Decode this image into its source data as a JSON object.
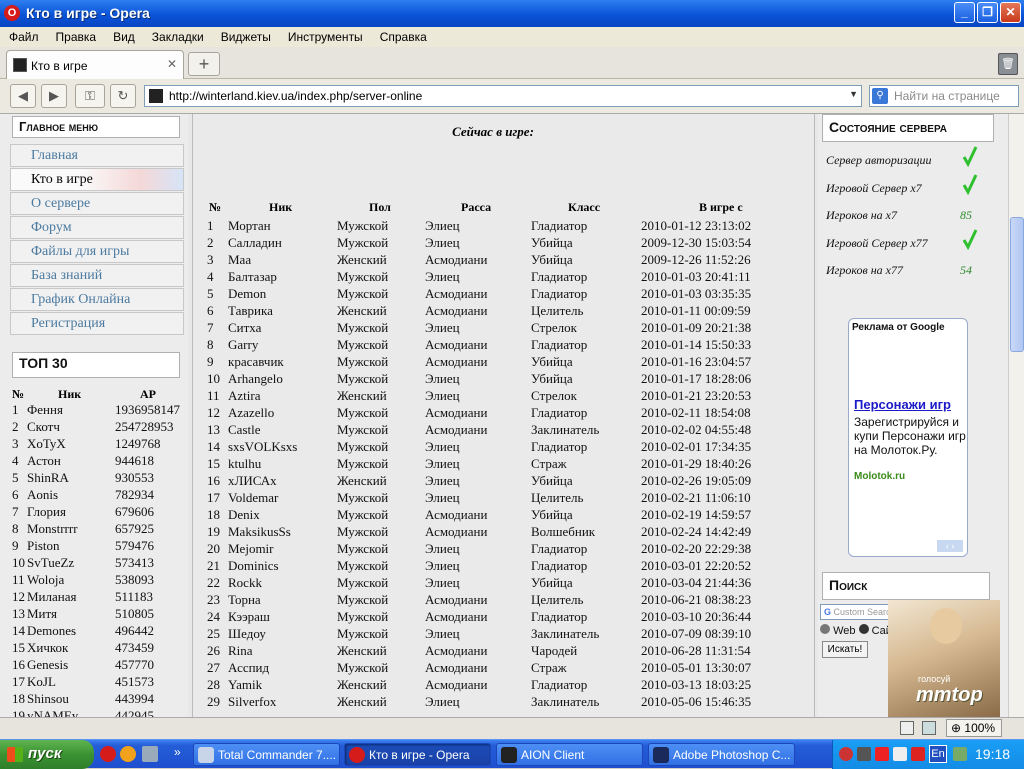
{
  "window": {
    "title": "Кто в игре - Opera"
  },
  "menu": [
    "Файл",
    "Правка",
    "Вид",
    "Закладки",
    "Виджеты",
    "Инструменты",
    "Справка"
  ],
  "tab": {
    "label": "Кто в игре"
  },
  "address": {
    "url": "http://winterland.kiev.ua/index.php/server-online",
    "find_placeholder": "Найти на странице"
  },
  "sidebar": {
    "main_menu_title": "Главное меню",
    "items": [
      "Главная",
      "Кто в игре",
      "О сервере",
      "Форум",
      "Файлы для игры",
      "База знаний",
      "График Онлайна",
      "Регистрация"
    ],
    "top_title": "ТОП 30",
    "top_headers": [
      "№",
      "Ник",
      "AP"
    ],
    "top_rows": [
      [
        "1",
        "Фення",
        "1936958147"
      ],
      [
        "2",
        "Скотч",
        "254728953"
      ],
      [
        "3",
        "XoTyX",
        "1249768"
      ],
      [
        "4",
        "Астон",
        "944618"
      ],
      [
        "5",
        "ShinRA",
        "930553"
      ],
      [
        "6",
        "Aonis",
        "782934"
      ],
      [
        "7",
        "Глория",
        "679606"
      ],
      [
        "8",
        "Monstrrrr",
        "657925"
      ],
      [
        "9",
        "Piston",
        "579476"
      ],
      [
        "10",
        "SvTueZz",
        "573413"
      ],
      [
        "11",
        "Woloja",
        "538093"
      ],
      [
        "12",
        "Миланая",
        "511183"
      ],
      [
        "13",
        "Митя",
        "510805"
      ],
      [
        "14",
        "Demones",
        "496442"
      ],
      [
        "15",
        "Хичкок",
        "473459"
      ],
      [
        "16",
        "Genesis",
        "457770"
      ],
      [
        "17",
        "KoJL",
        "451573"
      ],
      [
        "18",
        "Shinsou",
        "443994"
      ],
      [
        "19",
        "yNAMEy",
        "442945"
      ]
    ]
  },
  "main": {
    "title": "Сейчас в игре",
    "headers": [
      "№",
      "Ник",
      "Пол",
      "Расса",
      "Класс",
      "В игре с"
    ],
    "rows": [
      [
        "1",
        "Мортан",
        "Мужской",
        "Элиец",
        "Гладиатор",
        "2010-01-12 23:13:02"
      ],
      [
        "2",
        "Салладин",
        "Мужской",
        "Элиец",
        "Убийца",
        "2009-12-30 15:03:54"
      ],
      [
        "3",
        "Маа",
        "Женский",
        "Асмодиани",
        "Убийца",
        "2009-12-26 11:52:26"
      ],
      [
        "4",
        "Балтазар",
        "Мужской",
        "Элиец",
        "Гладиатор",
        "2010-01-03 20:41:11"
      ],
      [
        "5",
        "Demon",
        "Мужской",
        "Асмодиани",
        "Гладиатор",
        "2010-01-03 03:35:35"
      ],
      [
        "6",
        "Таврика",
        "Женский",
        "Асмодиани",
        "Целитель",
        "2010-01-11 00:09:59"
      ],
      [
        "7",
        "Ситха",
        "Мужской",
        "Элиец",
        "Стрелок",
        "2010-01-09 20:21:38"
      ],
      [
        "8",
        "Garry",
        "Мужской",
        "Асмодиани",
        "Гладиатор",
        "2010-01-14 15:50:33"
      ],
      [
        "9",
        "красавчик",
        "Мужской",
        "Асмодиани",
        "Убийца",
        "2010-01-16 23:04:57"
      ],
      [
        "10",
        "Arhangelo",
        "Мужской",
        "Элиец",
        "Убийца",
        "2010-01-17 18:28:06"
      ],
      [
        "11",
        "Aztira",
        "Женский",
        "Элиец",
        "Стрелок",
        "2010-01-21 23:20:53"
      ],
      [
        "12",
        "Azazello",
        "Мужской",
        "Асмодиани",
        "Гладиатор",
        "2010-02-11 18:54:08"
      ],
      [
        "13",
        "Castle",
        "Мужской",
        "Асмодиани",
        "Заклинатель",
        "2010-02-02 04:55:48"
      ],
      [
        "14",
        "sxsVOLKsxs",
        "Мужской",
        "Элиец",
        "Гладиатор",
        "2010-02-01 17:34:35"
      ],
      [
        "15",
        "ktulhu",
        "Мужской",
        "Элиец",
        "Страж",
        "2010-01-29 18:40:26"
      ],
      [
        "16",
        "хЛИСАх",
        "Женский",
        "Элиец",
        "Убийца",
        "2010-02-26 19:05:09"
      ],
      [
        "17",
        "Voldemar",
        "Мужской",
        "Элиец",
        "Целитель",
        "2010-02-21 11:06:10"
      ],
      [
        "18",
        "Denix",
        "Мужской",
        "Асмодиани",
        "Убийца",
        "2010-02-19 14:59:57"
      ],
      [
        "19",
        "MaksikusSs",
        "Мужской",
        "Асмодиани",
        "Волшебник",
        "2010-02-24 14:42:49"
      ],
      [
        "20",
        "Mejomir",
        "Мужской",
        "Элиец",
        "Гладиатор",
        "2010-02-20 22:29:38"
      ],
      [
        "21",
        "Dominics",
        "Мужской",
        "Элиец",
        "Гладиатор",
        "2010-03-01 22:20:52"
      ],
      [
        "22",
        "Rockk",
        "Мужской",
        "Элиец",
        "Убийца",
        "2010-03-04 21:44:36"
      ],
      [
        "23",
        "Торна",
        "Мужской",
        "Асмодиани",
        "Целитель",
        "2010-06-21 08:38:23"
      ],
      [
        "24",
        "Кээраш",
        "Мужской",
        "Асмодиани",
        "Гладиатор",
        "2010-03-10 20:36:44"
      ],
      [
        "25",
        "Шедоу",
        "Мужской",
        "Элиец",
        "Заклинатель",
        "2010-07-09 08:39:10"
      ],
      [
        "26",
        "Rina",
        "Женский",
        "Асмодиани",
        "Чародей",
        "2010-06-28 11:31:54"
      ],
      [
        "27",
        "Асспид",
        "Мужской",
        "Асмодиани",
        "Страж",
        "2010-05-01 13:30:07"
      ],
      [
        "28",
        "Yamik",
        "Женский",
        "Асмодиани",
        "Гладиатор",
        "2010-03-13 18:03:25"
      ],
      [
        "29",
        "Silverfox",
        "Женский",
        "Элиец",
        "Заклинатель",
        "2010-05-06 15:46:35"
      ]
    ]
  },
  "server": {
    "title": "Состояние сервера",
    "items": [
      {
        "label": "Сервер авторизации",
        "value": "",
        "ok": true
      },
      {
        "label": "Игровой Сервер x7",
        "value": "",
        "ok": true
      },
      {
        "label": "Игроков на x7",
        "value": "85",
        "ok": false
      },
      {
        "label": "Игровой Сервер x77",
        "value": "",
        "ok": true
      },
      {
        "label": "Игроков на x77",
        "value": "54",
        "ok": false
      }
    ]
  },
  "ad": {
    "header": "Реклама от Google",
    "title": "Персонажи игр",
    "body": "Зарегистрируйся и купи Персонажи игр на Молоток.Ру.",
    "url": "Molotok.ru"
  },
  "search": {
    "title": "Поиск",
    "placeholder": "Custom Search",
    "web": "Web",
    "site": "Сайту",
    "button": "Искать!",
    "mmtop": "mmtop",
    "mmtop_small": "голосуй"
  },
  "status": {
    "zoom": "100%"
  },
  "taskbar": {
    "start": "пуск",
    "apps": [
      "Total Commander 7....",
      "Кто в игре - Opera",
      "AION Client",
      "Adobe Photoshop C..."
    ],
    "lang": "En",
    "time": "19:18"
  },
  "colors": {
    "accent_blue": "#0a53d8",
    "check_green": "#2ec02e"
  }
}
